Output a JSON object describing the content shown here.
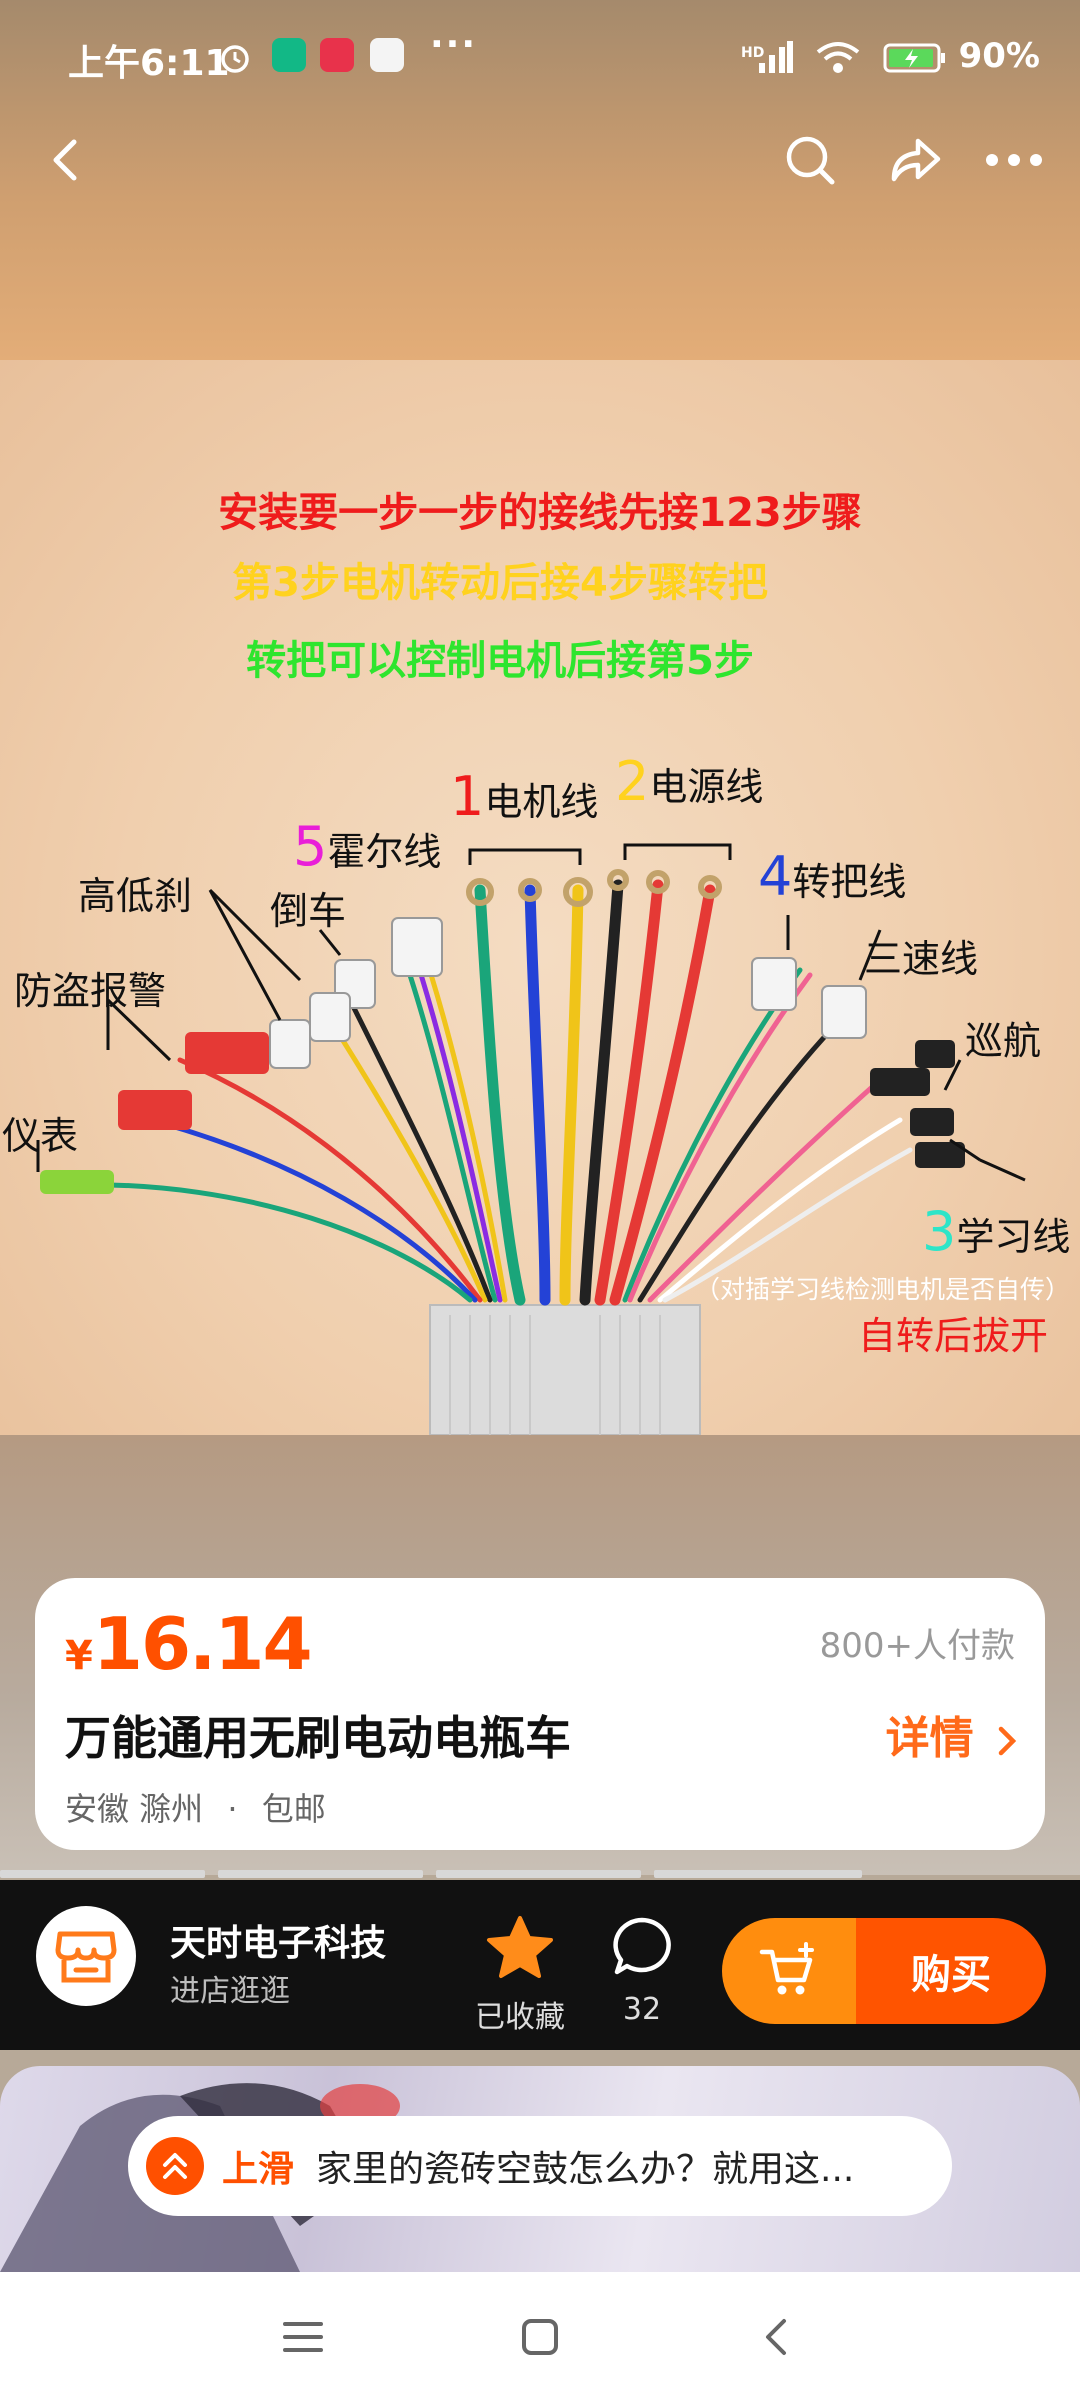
{
  "status_bar": {
    "time": "上午6:11",
    "more": "···",
    "battery": "90%",
    "signal": "HD"
  },
  "product_image": {
    "line1": "安装要一步一步的接线先接123步骤",
    "line2": "第3步电机转动后接4步骤转把",
    "line3": "转把可以控制电机后接第5步",
    "labels": {
      "motor_num": "1",
      "motor": "电机线",
      "power_num": "2",
      "power": "电源线",
      "hall_num": "5",
      "hall": "霍尔线",
      "throttle_num": "4",
      "throttle": "转把线",
      "learn_num": "3",
      "learn": "学习线",
      "reverse": "倒车",
      "brake": "高低刹",
      "alarm": "防盗报警",
      "meter": "仪表",
      "three_speed": "三速线",
      "cruise": "巡航",
      "learn_note": "（对插学习线检测电机是否自传）",
      "unplug": "自转后拔开"
    }
  },
  "card": {
    "currency": "¥",
    "price": "16.14",
    "buyers": "800+人付款",
    "title": "万能通用无刷电动电瓶车",
    "details": "详情",
    "location": "安徽 滁州",
    "dot": "·",
    "shipping": "包邮"
  },
  "store": {
    "name": "天时电子科技",
    "link": "进店逛逛",
    "favorite": "已收藏",
    "comments": "32",
    "buy": "购买"
  },
  "next_video": {
    "up": "上滑",
    "title": "家里的瓷砖空鼓怎么办？就用这..."
  },
  "colors": {
    "accent": "#ff5000",
    "cart": "#ff8d0e"
  }
}
